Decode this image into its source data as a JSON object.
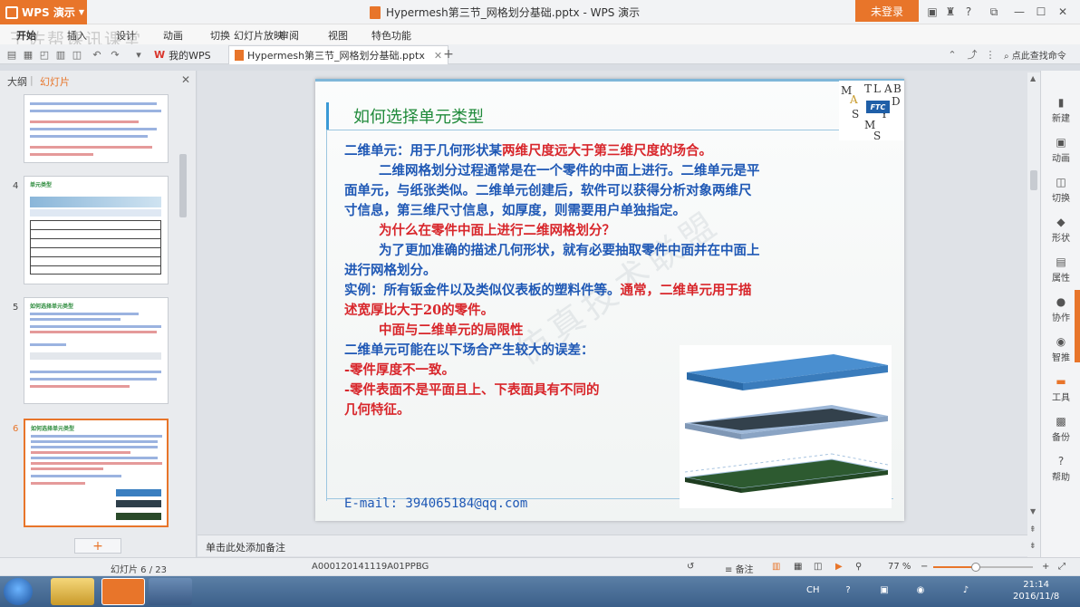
{
  "app": {
    "name": "WPS 演示",
    "window_title": "Hypermesh第三节_网格划分基础.pptx - WPS 演示",
    "login_label": "未登录",
    "accent": "#e8752a"
  },
  "menu": {
    "tabs": [
      "开始",
      "插入",
      "设计",
      "动画",
      "切换",
      "幻灯片放映",
      "审阅",
      "视图",
      "特色功能"
    ],
    "watermark": "王佐帮课讯课堂"
  },
  "doc_tabs": [
    {
      "label": "我的WPS"
    },
    {
      "label": "Hypermesh第三节_网格划分基础.pptx"
    }
  ],
  "search_cmd": "点此查找命令",
  "left_panel": {
    "outline_label": "大纲",
    "slides_label": "幻灯片",
    "thumbs": [
      {
        "num": "4",
        "title": "单元类型"
      },
      {
        "num": "5",
        "title": "如何选择单元类型"
      },
      {
        "num": "6",
        "title": "如何选择单元类型"
      }
    ],
    "add_label": "+"
  },
  "slide": {
    "title": "如何选择单元类型",
    "logo_letters": [
      "M",
      "T",
      "L",
      "A",
      "B",
      "A",
      "D",
      "S",
      "Y",
      "M",
      "S"
    ],
    "logo_ftc": "FTC",
    "watermark": "仿真技术联盟",
    "lines": [
      {
        "text": "二维单元：用于几何形状某",
        "color": "blue"
      },
      {
        "text": "两维尺度远大于第三维尺度的场合。",
        "color": "blue"
      },
      {
        "text": "二维网格划分过程通常是在一个零件的中面上进行。二维单元是平",
        "color": "blue"
      },
      {
        "text": "面单元，与纸张类似。二维单元创建后，软件可以获得分析对象两维尺",
        "color": "blue"
      },
      {
        "text": "寸信息，第三维尺寸信息，如厚度，则需要用户单独指定。",
        "color": "blue"
      },
      {
        "text": "为什么在零件中面上进行二维网格划分？",
        "color": "red"
      },
      {
        "text": "为了更加准确的描述几何形状，就有必要抽取零件中面并在中面上",
        "color": "blue"
      },
      {
        "text": "进行网格划分。",
        "color": "blue"
      },
      {
        "text": "实例：所有钣金件以及类似仪表板的塑料件等。",
        "color": "blue"
      },
      {
        "text": "通常，二维单元用于描",
        "color": "red"
      },
      {
        "text": "述宽厚比大于20的零件。",
        "color": "red"
      },
      {
        "text": "中面与二维单元的局限性",
        "color": "red"
      },
      {
        "text": "二维单元可能在以下场合产生较大的误差：",
        "color": "blue"
      },
      {
        "text": "-零件厚度不一致。",
        "color": "red"
      },
      {
        "text": "-零件表面不是平面且上、下表面具有不同的",
        "color": "red"
      },
      {
        "text": "几何特征。",
        "color": "red"
      }
    ],
    "email": "E-mail: 394065184@qq.com"
  },
  "right_bar": [
    {
      "label": "新建",
      "icon": "new-icon"
    },
    {
      "label": "动画",
      "icon": "animation-icon"
    },
    {
      "label": "切换",
      "icon": "transition-icon"
    },
    {
      "label": "形状",
      "icon": "shape-icon"
    },
    {
      "label": "属性",
      "icon": "properties-icon"
    },
    {
      "label": "协作",
      "icon": "collaborate-icon"
    },
    {
      "label": "智推",
      "icon": "recommend-icon"
    },
    {
      "label": "工具",
      "icon": "tools-icon"
    },
    {
      "label": "备份",
      "icon": "backup-icon"
    },
    {
      "label": "帮助",
      "icon": "help-icon"
    }
  ],
  "notes_placeholder": "单击此处添加备注",
  "status": {
    "slide_count": "幻灯片 6 / 23",
    "template": "A000120141119A01PPBG",
    "notes_label": "备注",
    "zoom": "77 %",
    "zoom_fraction": 0.43
  },
  "taskbar": {
    "time": "21:14",
    "date": "2016/11/8",
    "lang": "CH"
  }
}
